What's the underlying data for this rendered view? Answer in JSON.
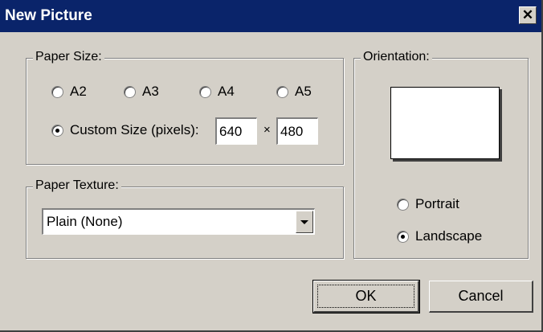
{
  "window": {
    "title": "New Picture",
    "close_symbol": "✕"
  },
  "paper_size": {
    "legend": "Paper Size:",
    "options": [
      "A2",
      "A3",
      "A4",
      "A5"
    ],
    "custom_label": "Custom Size (pixels):",
    "width": "640",
    "times": "×",
    "height": "480",
    "selected": "custom"
  },
  "paper_texture": {
    "legend": "Paper Texture:",
    "value": "Plain (None)"
  },
  "orientation": {
    "legend": "Orientation:",
    "portrait": "Portrait",
    "landscape": "Landscape",
    "selected": "landscape"
  },
  "buttons": {
    "ok": "OK",
    "cancel": "Cancel"
  },
  "icons": {
    "close": "close-icon",
    "dropdown": "chevron-down-icon"
  }
}
